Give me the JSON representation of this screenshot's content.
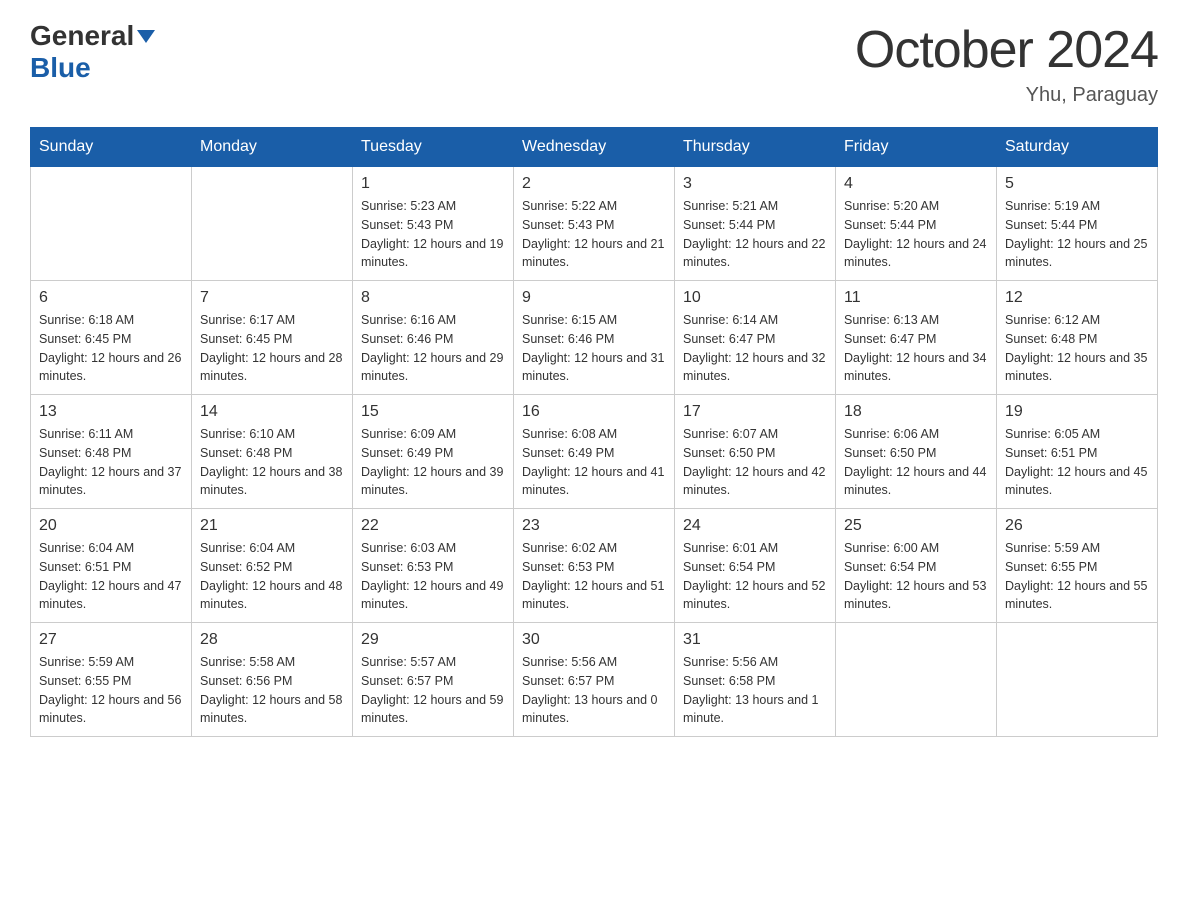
{
  "header": {
    "logo_general": "General",
    "logo_blue": "Blue",
    "month_title": "October 2024",
    "location": "Yhu, Paraguay"
  },
  "days_of_week": [
    "Sunday",
    "Monday",
    "Tuesday",
    "Wednesday",
    "Thursday",
    "Friday",
    "Saturday"
  ],
  "weeks": [
    [
      {
        "day": "",
        "sunrise": "",
        "sunset": "",
        "daylight": ""
      },
      {
        "day": "",
        "sunrise": "",
        "sunset": "",
        "daylight": ""
      },
      {
        "day": "1",
        "sunrise": "Sunrise: 5:23 AM",
        "sunset": "Sunset: 5:43 PM",
        "daylight": "Daylight: 12 hours and 19 minutes."
      },
      {
        "day": "2",
        "sunrise": "Sunrise: 5:22 AM",
        "sunset": "Sunset: 5:43 PM",
        "daylight": "Daylight: 12 hours and 21 minutes."
      },
      {
        "day": "3",
        "sunrise": "Sunrise: 5:21 AM",
        "sunset": "Sunset: 5:44 PM",
        "daylight": "Daylight: 12 hours and 22 minutes."
      },
      {
        "day": "4",
        "sunrise": "Sunrise: 5:20 AM",
        "sunset": "Sunset: 5:44 PM",
        "daylight": "Daylight: 12 hours and 24 minutes."
      },
      {
        "day": "5",
        "sunrise": "Sunrise: 5:19 AM",
        "sunset": "Sunset: 5:44 PM",
        "daylight": "Daylight: 12 hours and 25 minutes."
      }
    ],
    [
      {
        "day": "6",
        "sunrise": "Sunrise: 6:18 AM",
        "sunset": "Sunset: 6:45 PM",
        "daylight": "Daylight: 12 hours and 26 minutes."
      },
      {
        "day": "7",
        "sunrise": "Sunrise: 6:17 AM",
        "sunset": "Sunset: 6:45 PM",
        "daylight": "Daylight: 12 hours and 28 minutes."
      },
      {
        "day": "8",
        "sunrise": "Sunrise: 6:16 AM",
        "sunset": "Sunset: 6:46 PM",
        "daylight": "Daylight: 12 hours and 29 minutes."
      },
      {
        "day": "9",
        "sunrise": "Sunrise: 6:15 AM",
        "sunset": "Sunset: 6:46 PM",
        "daylight": "Daylight: 12 hours and 31 minutes."
      },
      {
        "day": "10",
        "sunrise": "Sunrise: 6:14 AM",
        "sunset": "Sunset: 6:47 PM",
        "daylight": "Daylight: 12 hours and 32 minutes."
      },
      {
        "day": "11",
        "sunrise": "Sunrise: 6:13 AM",
        "sunset": "Sunset: 6:47 PM",
        "daylight": "Daylight: 12 hours and 34 minutes."
      },
      {
        "day": "12",
        "sunrise": "Sunrise: 6:12 AM",
        "sunset": "Sunset: 6:48 PM",
        "daylight": "Daylight: 12 hours and 35 minutes."
      }
    ],
    [
      {
        "day": "13",
        "sunrise": "Sunrise: 6:11 AM",
        "sunset": "Sunset: 6:48 PM",
        "daylight": "Daylight: 12 hours and 37 minutes."
      },
      {
        "day": "14",
        "sunrise": "Sunrise: 6:10 AM",
        "sunset": "Sunset: 6:48 PM",
        "daylight": "Daylight: 12 hours and 38 minutes."
      },
      {
        "day": "15",
        "sunrise": "Sunrise: 6:09 AM",
        "sunset": "Sunset: 6:49 PM",
        "daylight": "Daylight: 12 hours and 39 minutes."
      },
      {
        "day": "16",
        "sunrise": "Sunrise: 6:08 AM",
        "sunset": "Sunset: 6:49 PM",
        "daylight": "Daylight: 12 hours and 41 minutes."
      },
      {
        "day": "17",
        "sunrise": "Sunrise: 6:07 AM",
        "sunset": "Sunset: 6:50 PM",
        "daylight": "Daylight: 12 hours and 42 minutes."
      },
      {
        "day": "18",
        "sunrise": "Sunrise: 6:06 AM",
        "sunset": "Sunset: 6:50 PM",
        "daylight": "Daylight: 12 hours and 44 minutes."
      },
      {
        "day": "19",
        "sunrise": "Sunrise: 6:05 AM",
        "sunset": "Sunset: 6:51 PM",
        "daylight": "Daylight: 12 hours and 45 minutes."
      }
    ],
    [
      {
        "day": "20",
        "sunrise": "Sunrise: 6:04 AM",
        "sunset": "Sunset: 6:51 PM",
        "daylight": "Daylight: 12 hours and 47 minutes."
      },
      {
        "day": "21",
        "sunrise": "Sunrise: 6:04 AM",
        "sunset": "Sunset: 6:52 PM",
        "daylight": "Daylight: 12 hours and 48 minutes."
      },
      {
        "day": "22",
        "sunrise": "Sunrise: 6:03 AM",
        "sunset": "Sunset: 6:53 PM",
        "daylight": "Daylight: 12 hours and 49 minutes."
      },
      {
        "day": "23",
        "sunrise": "Sunrise: 6:02 AM",
        "sunset": "Sunset: 6:53 PM",
        "daylight": "Daylight: 12 hours and 51 minutes."
      },
      {
        "day": "24",
        "sunrise": "Sunrise: 6:01 AM",
        "sunset": "Sunset: 6:54 PM",
        "daylight": "Daylight: 12 hours and 52 minutes."
      },
      {
        "day": "25",
        "sunrise": "Sunrise: 6:00 AM",
        "sunset": "Sunset: 6:54 PM",
        "daylight": "Daylight: 12 hours and 53 minutes."
      },
      {
        "day": "26",
        "sunrise": "Sunrise: 5:59 AM",
        "sunset": "Sunset: 6:55 PM",
        "daylight": "Daylight: 12 hours and 55 minutes."
      }
    ],
    [
      {
        "day": "27",
        "sunrise": "Sunrise: 5:59 AM",
        "sunset": "Sunset: 6:55 PM",
        "daylight": "Daylight: 12 hours and 56 minutes."
      },
      {
        "day": "28",
        "sunrise": "Sunrise: 5:58 AM",
        "sunset": "Sunset: 6:56 PM",
        "daylight": "Daylight: 12 hours and 58 minutes."
      },
      {
        "day": "29",
        "sunrise": "Sunrise: 5:57 AM",
        "sunset": "Sunset: 6:57 PM",
        "daylight": "Daylight: 12 hours and 59 minutes."
      },
      {
        "day": "30",
        "sunrise": "Sunrise: 5:56 AM",
        "sunset": "Sunset: 6:57 PM",
        "daylight": "Daylight: 13 hours and 0 minutes."
      },
      {
        "day": "31",
        "sunrise": "Sunrise: 5:56 AM",
        "sunset": "Sunset: 6:58 PM",
        "daylight": "Daylight: 13 hours and 1 minute."
      },
      {
        "day": "",
        "sunrise": "",
        "sunset": "",
        "daylight": ""
      },
      {
        "day": "",
        "sunrise": "",
        "sunset": "",
        "daylight": ""
      }
    ]
  ]
}
